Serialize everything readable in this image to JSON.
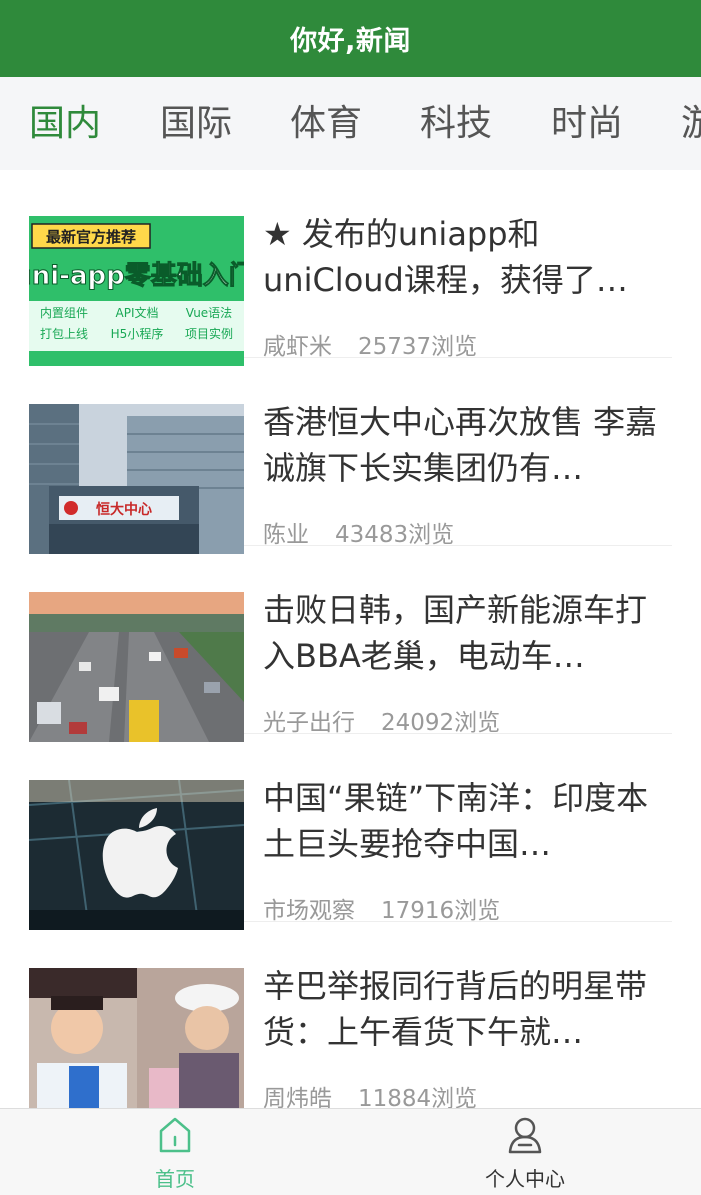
{
  "header": {
    "title": "你好,新闻"
  },
  "tabs": [
    {
      "label": "国内",
      "active": true
    },
    {
      "label": "国际",
      "active": false
    },
    {
      "label": "体育",
      "active": false
    },
    {
      "label": "科技",
      "active": false
    },
    {
      "label": "时尚",
      "active": false
    },
    {
      "label": "游",
      "active": false
    }
  ],
  "thumb1": {
    "badge": "最新官方推荐",
    "banner": "uni-app零基础入门",
    "tags": [
      "内置组件",
      "API文档",
      "Vue语法",
      "打包上线",
      "H5小程序",
      "项目实例"
    ]
  },
  "thumb2": {
    "sign": "恒大中心"
  },
  "news": [
    {
      "title": "★ 发布的uniapp和uniCloud课程，获得了…",
      "author": "咸虾米",
      "views": "25737浏览"
    },
    {
      "title": "香港恒大中心再次放售 李嘉诚旗下长实集团仍有…",
      "author": "陈业",
      "views": "43483浏览"
    },
    {
      "title": "击败日韩，国产新能源车打入BBA老巢，电动车…",
      "author": "光子出行",
      "views": "24092浏览"
    },
    {
      "title": "中国“果链”下南洋：印度本土巨头要抢夺中国…",
      "author": "市场观察",
      "views": "17916浏览"
    },
    {
      "title": "辛巴举报同行背后的明星带货：上午看货下午就…",
      "author": "周炜皓",
      "views": "11884浏览"
    }
  ],
  "tabbar": [
    {
      "label": "首页",
      "icon": "home-icon",
      "active": true
    },
    {
      "label": "个人中心",
      "icon": "user-icon",
      "active": false
    }
  ],
  "colors": {
    "brand": "#2f8a3b",
    "tab_active": "#2f8a3b",
    "tabbar_active": "#4cc08a"
  }
}
